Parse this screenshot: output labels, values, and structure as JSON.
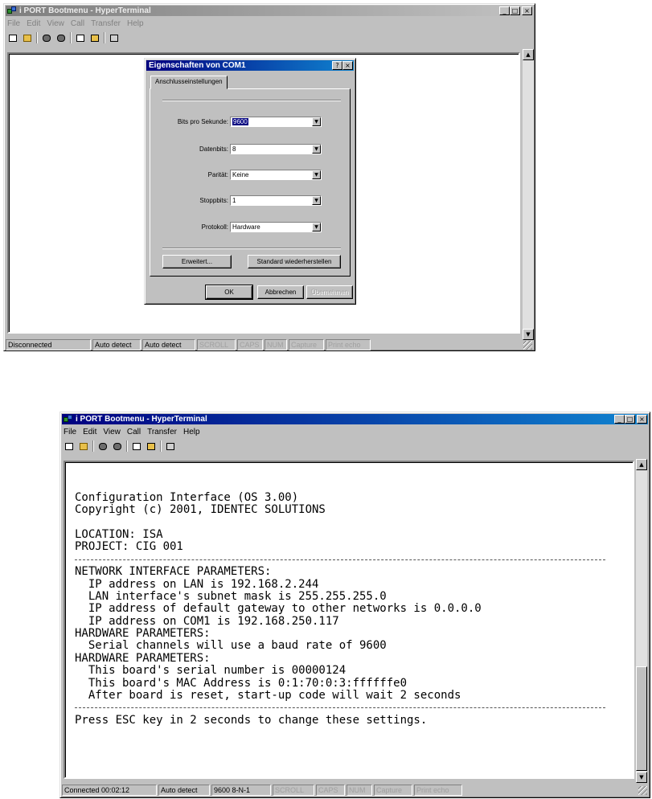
{
  "window1": {
    "title": "i PORT Bootmenu - HyperTerminal",
    "menu": [
      "File",
      "Edit",
      "View",
      "Call",
      "Transfer",
      "Help"
    ],
    "menu_state": "dimmed",
    "status": [
      "Disconnected",
      "Auto detect",
      "Auto detect",
      "SCROLL",
      "CAPS",
      "NUM",
      "Capture",
      "Print echo"
    ]
  },
  "dialog": {
    "title": "Eigenschaften von COM1",
    "help_button": "?",
    "close_button": "×",
    "tab": "Anschlusseinstellungen",
    "fields": [
      {
        "label": "Bits pro Sekunde:",
        "value": "9600"
      },
      {
        "label": "Datenbits:",
        "value": "8"
      },
      {
        "label": "Parität:",
        "value": "Keine"
      },
      {
        "label": "Stoppbits:",
        "value": "1"
      },
      {
        "label": "Protokoll:",
        "value": "Hardware"
      }
    ],
    "advanced_button": "Erweitert...",
    "restore_button": "Standard wiederherstellen",
    "ok_button": "OK",
    "cancel_button": "Abbrechen",
    "apply_button": "Übernehmen"
  },
  "window2": {
    "title": "i PORT Bootmenu - HyperTerminal",
    "menu": [
      "File",
      "Edit",
      "View",
      "Call",
      "Transfer",
      "Help"
    ],
    "status": [
      "Connected 00:02:12",
      "Auto detect",
      "9600 8-N-1",
      "SCROLL",
      "CAPS",
      "NUM",
      "Capture",
      "Print echo"
    ],
    "terminal_lines": [
      "",
      "",
      "Configuration Interface (OS 3.00)",
      "Copyright (c) 2001, IDENTEC SOLUTIONS",
      "",
      "LOCATION: ISA",
      "PROJECT: CIG 001",
      "---",
      "NETWORK INTERFACE PARAMETERS:",
      "  IP address on LAN is 192.168.2.244",
      "  LAN interface's subnet mask is 255.255.255.0",
      "  IP address of default gateway to other networks is 0.0.0.0",
      "  IP address on COM1 is 192.168.250.117",
      "HARDWARE PARAMETERS:",
      "  Serial channels will use a baud rate of 9600",
      "HARDWARE PARAMETERS:",
      "  This board's serial number is 00000124",
      "  This board's MAC Address is 0:1:70:0:3:ffffffe0",
      "  After board is reset, start-up code will wait 2 seconds",
      "---",
      "Press ESC key in 2 seconds to change these settings."
    ]
  },
  "icons": {
    "toolbar": [
      "new-icon",
      "open-icon",
      "connect-icon",
      "disconnect-icon",
      "send-icon",
      "receive-icon",
      "properties-icon"
    ],
    "window_buttons": [
      "minimize-icon",
      "maximize-icon",
      "close-icon"
    ],
    "scroll": [
      "scroll-up-icon",
      "scroll-down-icon"
    ]
  },
  "colors": {
    "titlebar_active": "#000080",
    "titlebar_inactive": "#808080",
    "face": "#c0c0c0",
    "selection": "#000080"
  }
}
